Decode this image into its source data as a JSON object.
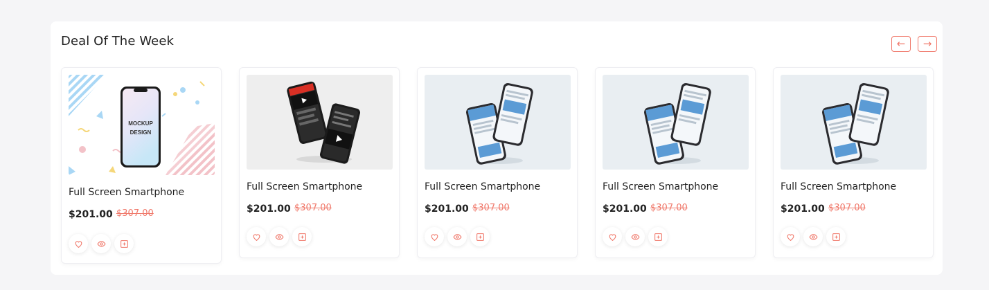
{
  "section": {
    "title": "Deal Of The Week",
    "prev_icon": "arrow-left",
    "next_icon": "arrow-right"
  },
  "accent": "#f0786a",
  "products": [
    {
      "title": "Full Screen Smartphone",
      "price": "$201.00",
      "old_price": "$307.00",
      "image": "colorful-mockup-phone",
      "mockup_text_1": "MOCKUP",
      "mockup_text_2": "DESIGN"
    },
    {
      "title": "Full Screen Smartphone",
      "price": "$201.00",
      "old_price": "$307.00",
      "image": "black-phones-video-app"
    },
    {
      "title": "Full Screen Smartphone",
      "price": "$201.00",
      "old_price": "$307.00",
      "image": "silver-phones-social-app"
    },
    {
      "title": "Full Screen Smartphone",
      "price": "$201.00",
      "old_price": "$307.00",
      "image": "silver-phones-social-app"
    },
    {
      "title": "Full Screen Smartphone",
      "price": "$201.00",
      "old_price": "$307.00",
      "image": "silver-phones-social-app"
    }
  ],
  "action_icons": [
    "heart-icon",
    "eye-icon",
    "plus-square-icon"
  ]
}
